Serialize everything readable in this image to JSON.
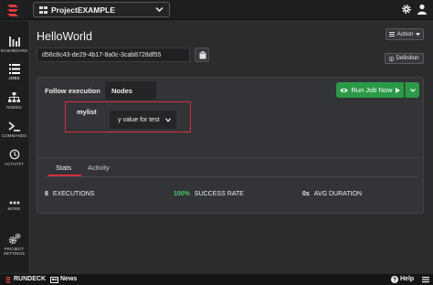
{
  "app": {
    "project_name": "ProjectEXAMPLE",
    "icons": {
      "logo": "rundeck-logo-icon",
      "project": "project-icon",
      "gear": "gear-icon",
      "user": "user-icon"
    }
  },
  "sidebar": {
    "items": [
      {
        "label": "DASHBOARD",
        "icon": "dashboard-icon"
      },
      {
        "label": "JOBS",
        "icon": "jobs-list-icon",
        "active": true
      },
      {
        "label": "NODES",
        "icon": "nodes-icon"
      },
      {
        "label": "COMMANDS",
        "icon": "terminal-icon"
      },
      {
        "label": "ACTIVITY",
        "icon": "history-icon"
      },
      {
        "label": "MORE",
        "icon": "more-dots-icon"
      },
      {
        "label": "PROJECT",
        "label2": "SETTINGS",
        "icon": "gears-icon"
      }
    ]
  },
  "job": {
    "title": "HelloWorld",
    "uuid": "d56c8c43-de29-4b17-8a0c-3cab8728df55",
    "action_label": "Action",
    "definition_label": "Definition"
  },
  "execution": {
    "follow_label": "Follow execution",
    "follow_value": "Nodes",
    "run_label": "Run Job Now",
    "option_name": "mylist",
    "option_value": "y value for test"
  },
  "stats": {
    "tabs": [
      "Stats",
      "Activity"
    ],
    "active_tab": "Stats",
    "executions": {
      "value": "8",
      "label": "EXECUTIONS"
    },
    "success_rate": {
      "value": "100%",
      "label": "SUCCESS RATE"
    },
    "avg_duration": {
      "value": "0s",
      "label": "AVG DURATION"
    }
  },
  "footer": {
    "brand": "RUNDECK",
    "news_label": "News",
    "help_label": "Help"
  },
  "colors": {
    "accent_red": "#d6303a",
    "run_green": "#2b9a47",
    "success_green": "#4cc765"
  }
}
